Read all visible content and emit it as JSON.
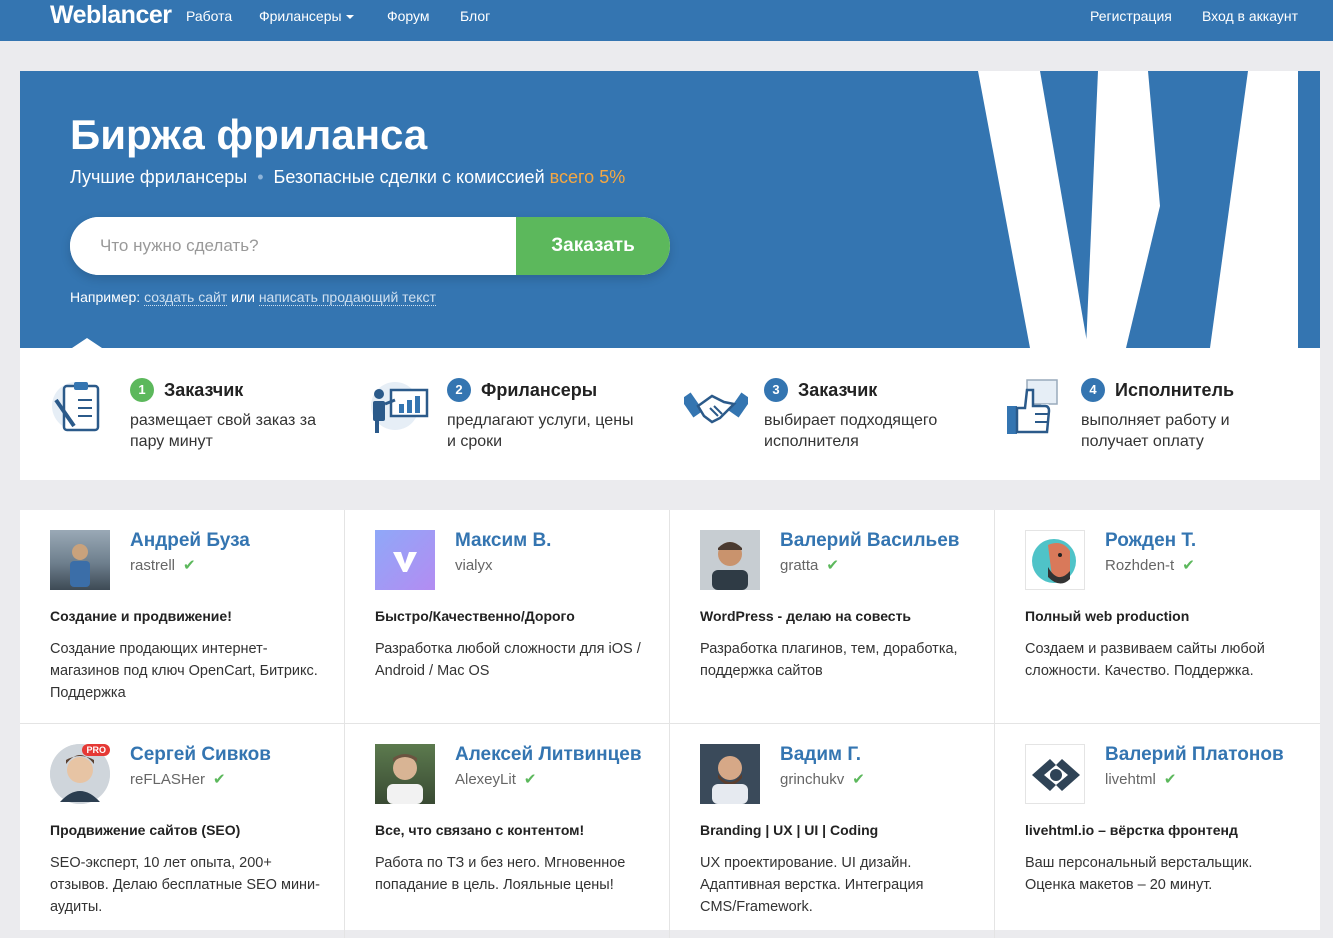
{
  "nav": {
    "logo": "Weblancer",
    "items": [
      "Работа",
      "Фрилансеры",
      "Форум",
      "Блог"
    ],
    "register": "Регистрация",
    "login": "Вход в аккаунт"
  },
  "hero": {
    "title": "Биржа фриланса",
    "sub_1": "Лучшие фрилансеры",
    "sub_sep": "•",
    "sub_2": "Безопасные сделки с комиссией",
    "sub_accent": "всего 5%",
    "search_placeholder": "Что нужно сделать?",
    "order_button": "Заказать",
    "example_prefix": "Например:",
    "example_link_1": "создать сайт",
    "example_or": "или",
    "example_link_2": "написать продающий текст"
  },
  "steps": [
    {
      "num": "1",
      "title": "Заказчик",
      "desc": "размещает свой заказ за пару минут",
      "icon": "clipboard-icon",
      "color": "#5cb85c"
    },
    {
      "num": "2",
      "title": "Фрилансеры",
      "desc": "предлагают услуги, цены и сроки",
      "icon": "presenter-icon",
      "color": "#3475b1"
    },
    {
      "num": "3",
      "title": "Заказчик",
      "desc": "выбирает подходящего исполнителя",
      "icon": "handshake-icon",
      "color": "#3475b1"
    },
    {
      "num": "4",
      "title": "Исполнитель",
      "desc": "выполняет работу и получает оплату",
      "icon": "thumbs-up-icon",
      "color": "#3475b1"
    }
  ],
  "freelancers": [
    {
      "name": "Андрей Буза",
      "login": "rastrell",
      "headline": "Создание и продвижение!",
      "desc": "Создание продающих интернет-магазинов под ключ OpenCart, Битрикс. Поддержка"
    },
    {
      "name": "Максим В.",
      "login": "vialyx",
      "headline": "Быстро/Качественно/Дорого",
      "desc": "Разработка любой сложности для iOS / Android / Mac OS"
    },
    {
      "name": "Валерий Васильев",
      "login": "gratta",
      "headline": "WordPress - делаю на совесть",
      "desc": "Разработка плагинов, тем, доработка, поддержка сайтов"
    },
    {
      "name": "Рожден Т.",
      "login": "Rozhden-t",
      "headline": "Полный web production",
      "desc": "Создаем и развиваем сайты любой сложности. Качество. Поддержка."
    },
    {
      "name": "Сергей Сивков",
      "login": "reFLASHer",
      "headline": "Продвижение сайтов (SEO)",
      "desc": "SEO-эксперт, 10 лет опыта, 200+ отзывов. Делаю бесплатные SEO мини-аудиты.",
      "pro": "PRO"
    },
    {
      "name": "Алексей Литвинцев",
      "login": "AlexeyLit",
      "headline": "Все, что связано с контентом!",
      "desc": "Работа по ТЗ и без него. Мгновенное попадание в цель. Лояльные цены!"
    },
    {
      "name": "Вадим Г.",
      "login": "grinchukv",
      "headline": "Branding | UX | UI | Coding",
      "desc": "UX проектирование. UI дизайн. Адаптивная верстка. Интеграция CMS/Framework."
    },
    {
      "name": "Валерий Платонов",
      "login": "livehtml",
      "headline": "livehtml.io – вёрстка фронтенд",
      "desc": "Ваш персональный верстальщик. Оценка макетов – 20 минут."
    }
  ],
  "colors": {
    "brand": "#3475b1",
    "accent": "#f5a742",
    "green": "#5cb85c"
  }
}
